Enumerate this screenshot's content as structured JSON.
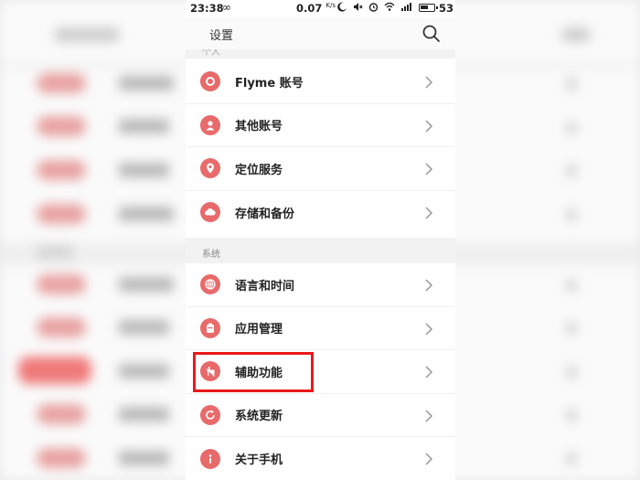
{
  "status_bar": {
    "time": "23:38",
    "loop_icon": "∞",
    "net_speed": "0.07",
    "net_unit": "K/s",
    "battery_level": "53"
  },
  "header": {
    "title": "设置",
    "search_icon": "search-icon"
  },
  "section_personal": {
    "label": "个人"
  },
  "personal_items": [
    {
      "label": "Flyme 账号",
      "icon": "account-icon"
    },
    {
      "label": "其他账号",
      "icon": "person-icon"
    },
    {
      "label": "定位服务",
      "icon": "location-icon"
    },
    {
      "label": "存储和备份",
      "icon": "cloud-icon"
    }
  ],
  "section_system": {
    "label": "系统"
  },
  "system_items": [
    {
      "label": "语言和时间",
      "icon": "globe-icon"
    },
    {
      "label": "应用管理",
      "icon": "app-icon"
    },
    {
      "label": "辅助功能",
      "icon": "hand-icon"
    },
    {
      "label": "系统更新",
      "icon": "refresh-icon"
    },
    {
      "label": "关于手机",
      "icon": "info-icon"
    }
  ],
  "colors": {
    "accent_icon": "#e86a6a",
    "highlight_border": "#e8191a",
    "section_bg": "#f2f2f2"
  }
}
